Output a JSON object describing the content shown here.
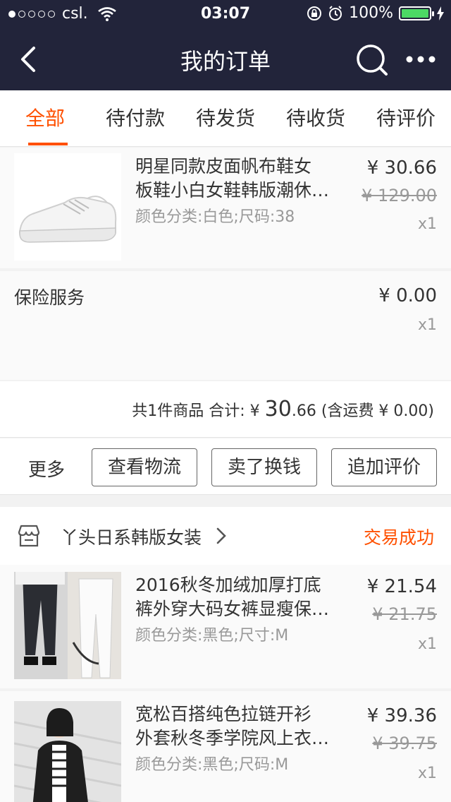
{
  "status_bar": {
    "carrier": "csl.",
    "time": "03:07",
    "battery": "100%"
  },
  "nav": {
    "title": "我的订单"
  },
  "tabs": [
    {
      "label": "全部",
      "active": true
    },
    {
      "label": "待付款",
      "active": false
    },
    {
      "label": "待发货",
      "active": false
    },
    {
      "label": "待收货",
      "active": false
    },
    {
      "label": "待评价",
      "active": false
    }
  ],
  "order1": {
    "item": {
      "title_line1": "明星同款皮面帆布鞋女",
      "title_line2": "板鞋小白女鞋韩版潮休…",
      "sku": "颜色分类:白色;尺码:38",
      "price": "¥ 30.66",
      "original_price": "¥ 129.00",
      "qty": "x1"
    },
    "insurance": {
      "label": "保险服务",
      "price": "¥ 0.00",
      "qty": "x1"
    },
    "summary": {
      "count": "共1件商品",
      "total_label": "合计:",
      "currency": "¥",
      "total_big": "30",
      "total_small": ".66",
      "shipping": "(含运费 ¥ 0.00)"
    },
    "actions": {
      "more": "更多",
      "logistics": "查看物流",
      "resell": "卖了换钱",
      "review": "追加评价"
    }
  },
  "order2": {
    "shop_name": "丫头日系韩版女装",
    "status": "交易成功",
    "items": [
      {
        "title_line1": "2016秋冬加绒加厚打底",
        "title_line2": "裤外穿大码女裤显瘦保…",
        "sku": "颜色分类:黑色;尺寸:M",
        "price": "¥ 21.54",
        "original_price": "¥ 21.75",
        "qty": "x1"
      },
      {
        "title_line1": "宽松百搭纯色拉链开衫",
        "title_line2": "外套秋冬季学院风上衣…",
        "sku": "颜色分类:黑色;尺码:M",
        "price": "¥ 39.36",
        "original_price": "¥ 39.75",
        "qty": "x1"
      }
    ]
  },
  "colors": {
    "accent": "#ff5000",
    "nav_bg": "#22243a"
  }
}
